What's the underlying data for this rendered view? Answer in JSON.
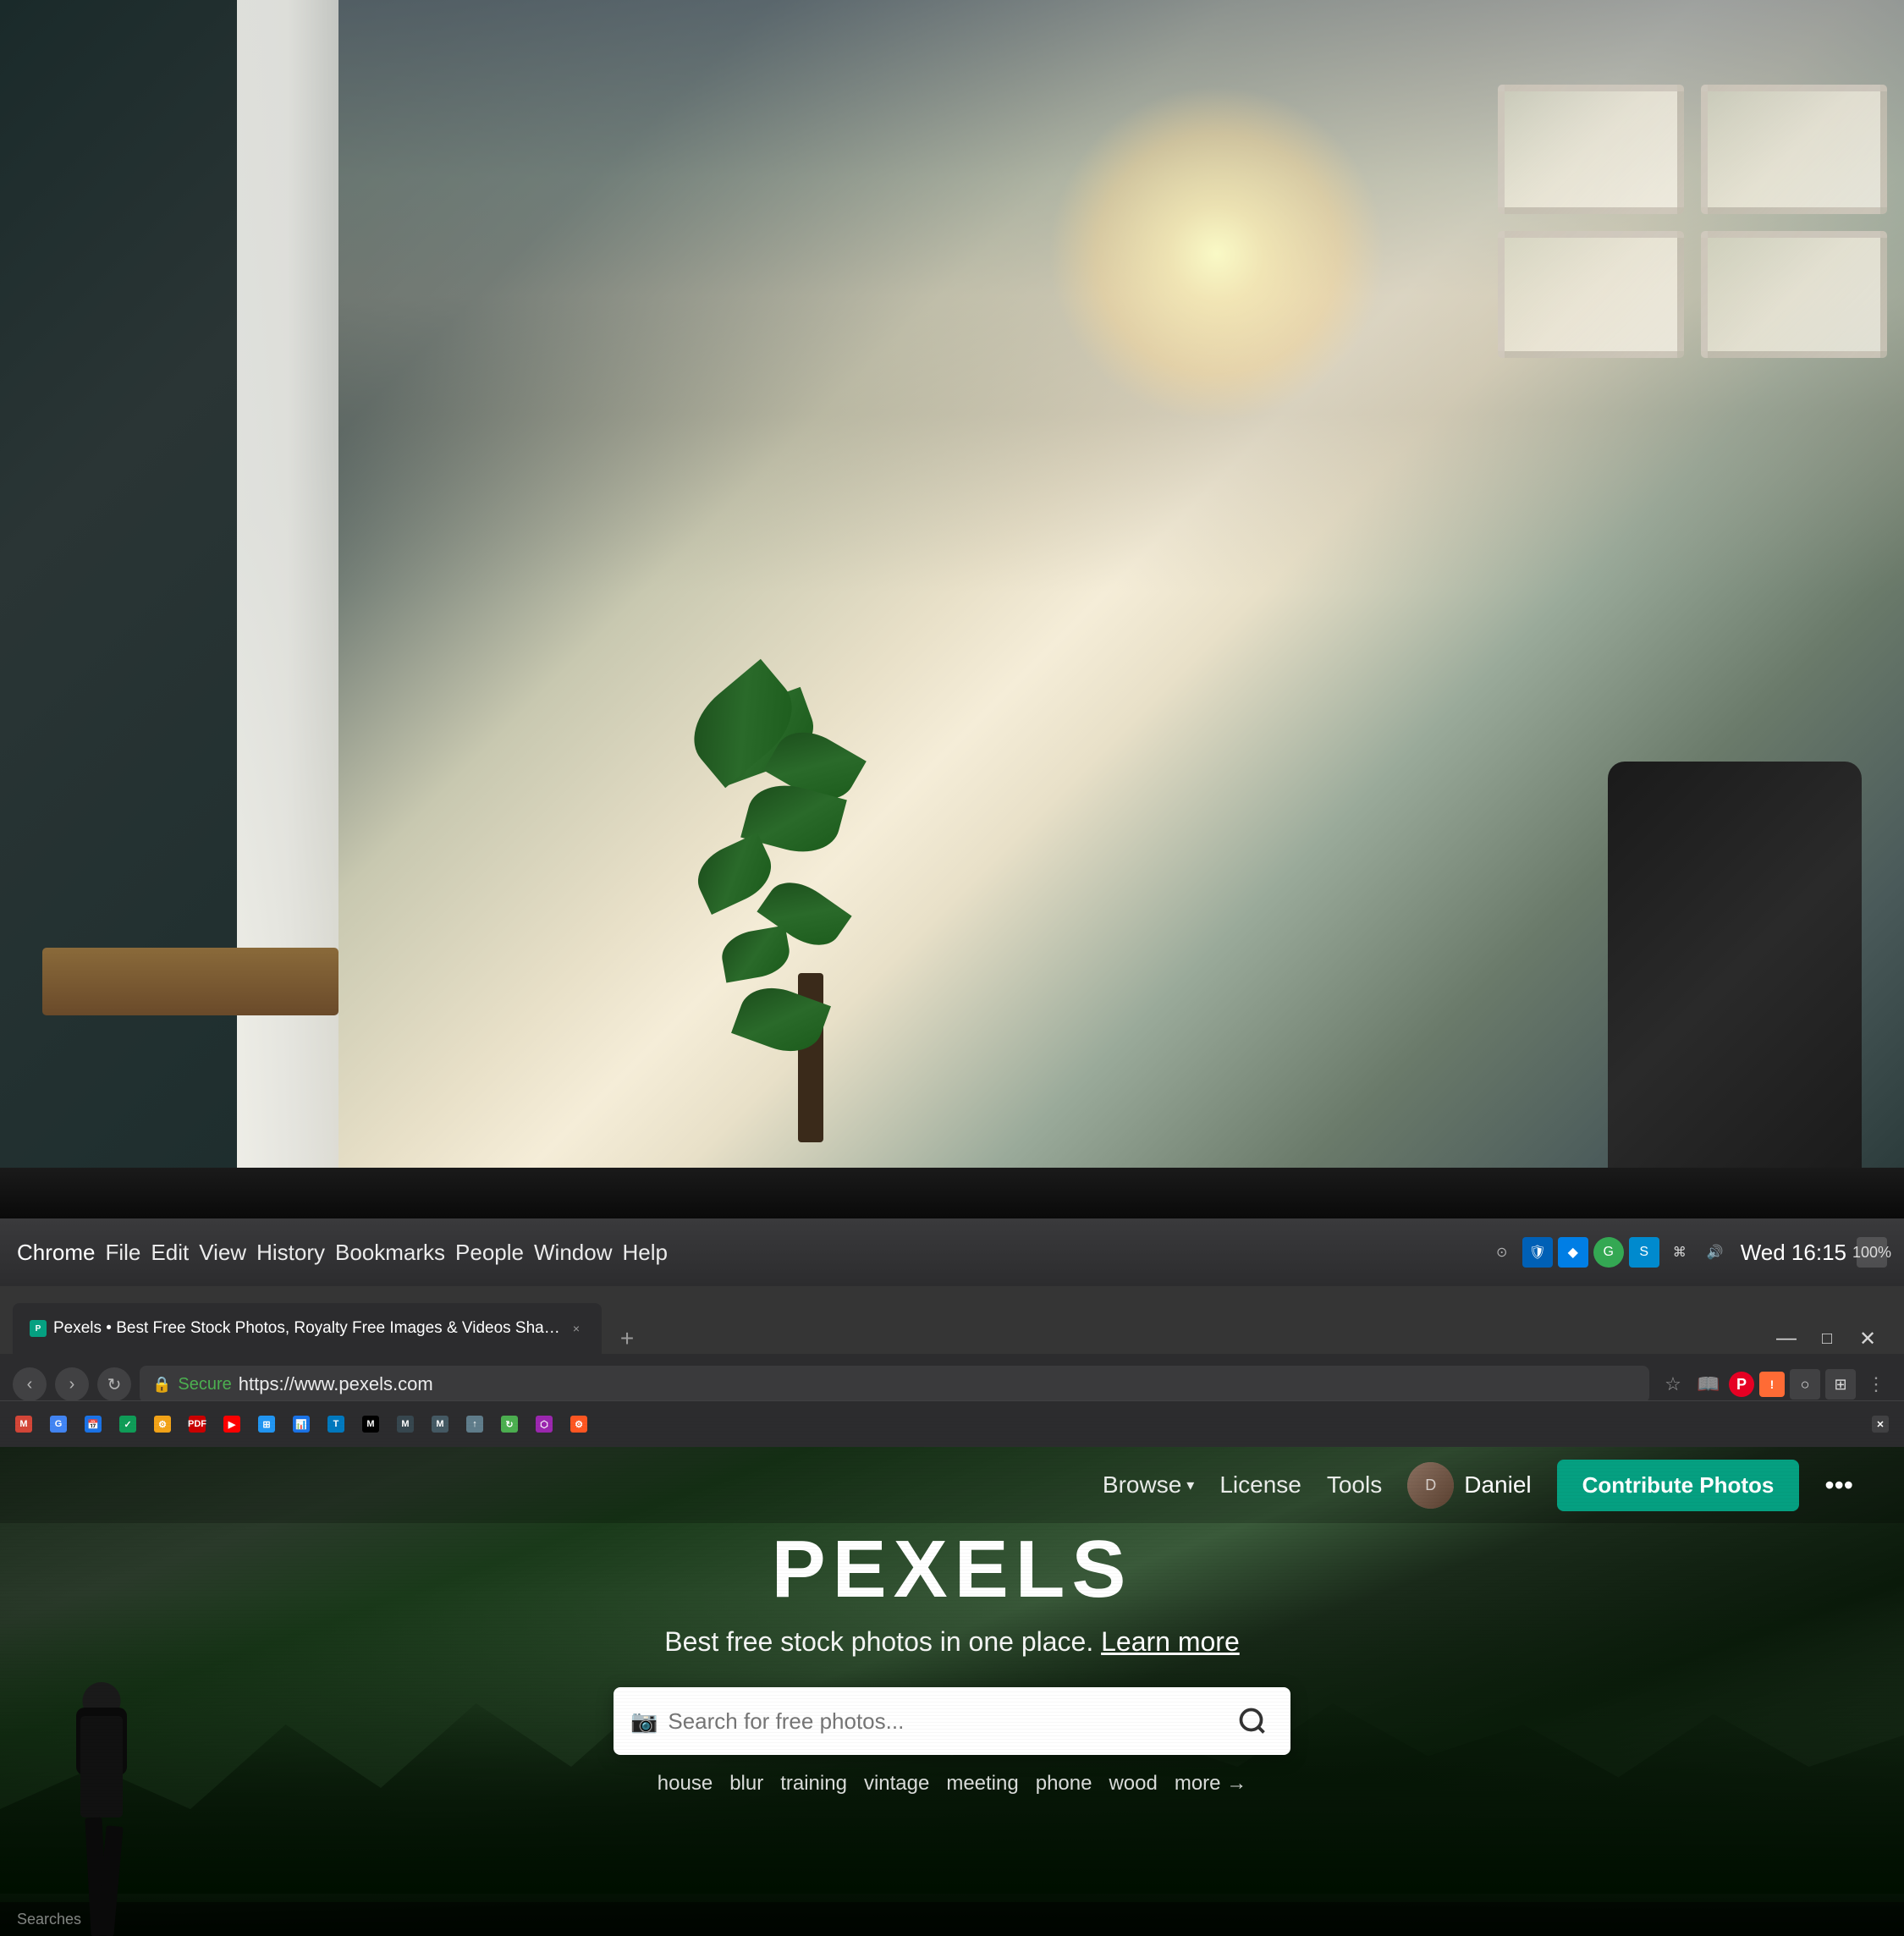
{
  "office": {
    "description": "Office background photo with blurred interior"
  },
  "macos_bar": {
    "menu_items": [
      "Chrome",
      "File",
      "Edit",
      "View",
      "History",
      "Bookmarks",
      "People",
      "Window",
      "Help"
    ],
    "clock": "Wed 16:15",
    "battery": "100%",
    "wifi": "WiFi",
    "volume": "Volume"
  },
  "chrome": {
    "tab_label": "Pexels • Best Free Stock Photos, Royalty Free Images & Videos Shared by Creators",
    "tab_close": "×",
    "address": "https://www.pexels.com",
    "secure_label": "Secure",
    "nav_back": "‹",
    "nav_forward": "›",
    "nav_refresh": "↻"
  },
  "bookmarks": {
    "items": [
      "M",
      "G",
      "Cal",
      "TD",
      "Tor",
      "PDF",
      "YT",
      "Docs",
      "Sheet",
      "Trello",
      "M",
      "M",
      "M"
    ]
  },
  "pexels": {
    "logo": "PEXELS",
    "tagline": "Best free stock photos in one place.",
    "tagline_link": "Learn more",
    "search_placeholder": "Search for free photos...",
    "nav": {
      "browse_label": "Browse",
      "license_label": "License",
      "tools_label": "Tools",
      "user_name": "Daniel",
      "contribute_label": "Contribute Photos",
      "more_label": "•••"
    },
    "quick_tags": [
      "house",
      "blur",
      "training",
      "vintage",
      "meeting",
      "phone",
      "wood",
      "more →"
    ]
  },
  "bottom": {
    "text": "Searches"
  }
}
